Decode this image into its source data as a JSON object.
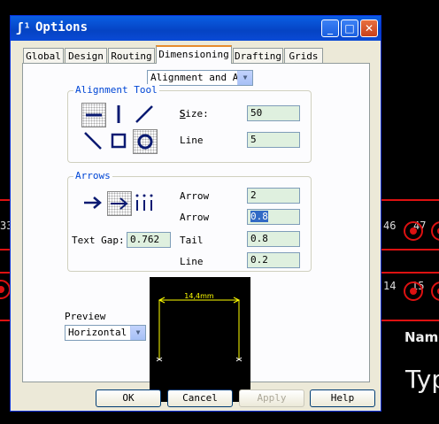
{
  "window": {
    "title": "Options",
    "icon": "app-logo-icon"
  },
  "title_buttons": {
    "minimize": "minimize-icon",
    "maximize": "maximize-icon",
    "close": "close-icon"
  },
  "tabs": [
    "Global",
    "Design",
    "Routing",
    "Dimensioning",
    "Drafting",
    "Grids"
  ],
  "active_tab": "Dimensioning",
  "mode_select": {
    "value": "Alignment and Ar"
  },
  "alignment_tool": {
    "legend": "Alignment Tool",
    "size_label": "Size:",
    "size_value": "50",
    "line_label": "Line",
    "line_value": "5",
    "selected_tools": [
      "horizontal",
      "circle"
    ]
  },
  "arrows": {
    "legend": "Arrows",
    "text_gap_label": "Text Gap:",
    "text_gap_value": "0.762",
    "arrow1_label": "Arrow",
    "arrow1_value": "2",
    "arrow2_label": "Arrow",
    "arrow2_value": "0.8",
    "tail_label": "Tail",
    "tail_value": "0.8",
    "line_label": "Line",
    "line_value": "0.2"
  },
  "preview": {
    "label": "Preview",
    "orientation": "Horizontal",
    "dimension_text": "14,4mm"
  },
  "buttons": {
    "ok": "OK",
    "cancel": "Cancel",
    "apply": "Apply",
    "help": "Help"
  },
  "background": {
    "pad_labels_left": [
      "33"
    ],
    "pad_labels_right_top": [
      "46",
      "47"
    ],
    "pad_labels_right_bottom": [
      "14",
      "15"
    ],
    "name_text": "Name",
    "type_text": "Typ"
  },
  "colors": {
    "title_bar": "#0a5fe4",
    "accent_tab": "#e68b2c",
    "field_bg": "#dff0df",
    "pcb_trace": "#dd1111"
  }
}
